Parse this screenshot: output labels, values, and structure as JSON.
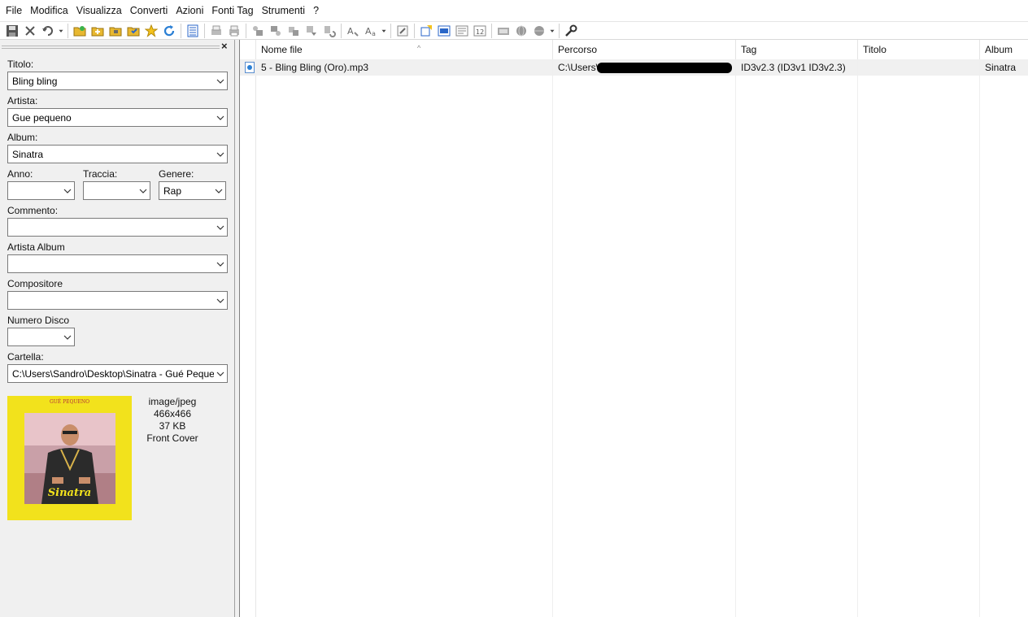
{
  "menubar": {
    "items": [
      "File",
      "Modifica",
      "Visualizza",
      "Converti",
      "Azioni",
      "Fonti Tag",
      "Strumenti",
      "?"
    ]
  },
  "toolbar": {
    "icons": [
      "save-icon",
      "remove-tag-icon",
      "undo-icon",
      "undo-dropdown-icon",
      "open-folder-icon",
      "add-folder-icon",
      "save-folder-icon",
      "favorite-folder-icon",
      "star-icon",
      "refresh-icon",
      "tag-panel-icon",
      "export-icon",
      "print-icon",
      "filename-to-tag-icon",
      "tag-to-filename-icon",
      "rename-icon",
      "tag-to-tag-icon",
      "text-to-tag-icon",
      "autonumber-icon",
      "case-conversion-icon",
      "case-dropdown-icon",
      "edit-tag-icon",
      "export-list-icon",
      "playlist-icon",
      "info-icon",
      "numbering-icon",
      "freedb-icon",
      "web-source-icon",
      "web-source-dropdown-icon",
      "options-icon"
    ]
  },
  "tag_panel": {
    "title_label": "Titolo:",
    "title_value": "Bling bling",
    "artist_label": "Artista:",
    "artist_value": "Gue pequeno",
    "album_label": "Album:",
    "album_value": "Sinatra",
    "year_label": "Anno:",
    "year_value": "",
    "track_label": "Traccia:",
    "track_value": "",
    "genre_label": "Genere:",
    "genre_value": "Rap",
    "comment_label": "Commento:",
    "comment_value": "",
    "album_artist_label": "Artista Album",
    "album_artist_value": "",
    "composer_label": "Compositore",
    "composer_value": "",
    "disc_label": "Numero Disco",
    "disc_value": "",
    "folder_label": "Cartella:",
    "folder_value": "C:\\Users\\Sandro\\Desktop\\Sinatra - Gué Pequeno",
    "cover": {
      "mime": "image/jpeg",
      "dimensions": "466x466",
      "size": "37 KB",
      "type": "Front Cover",
      "artwork_header": "GUÉ PEQUENO",
      "artwork_title": "Sinatra"
    }
  },
  "file_list": {
    "columns": [
      "Nome file",
      "Percorso",
      "Tag",
      "Titolo",
      "Album"
    ],
    "rows": [
      {
        "filename": "5 - Bling Bling (Oro).mp3",
        "path": "C:\\Users\\",
        "tag": "ID3v2.3 (ID3v1 ID3v2.3)",
        "title": "",
        "album": "Sinatra"
      }
    ]
  },
  "colors": {
    "panel_bg": "#f0f0f0",
    "cover_yellow": "#f2e21c",
    "row_selected": "#f0f0f0"
  }
}
